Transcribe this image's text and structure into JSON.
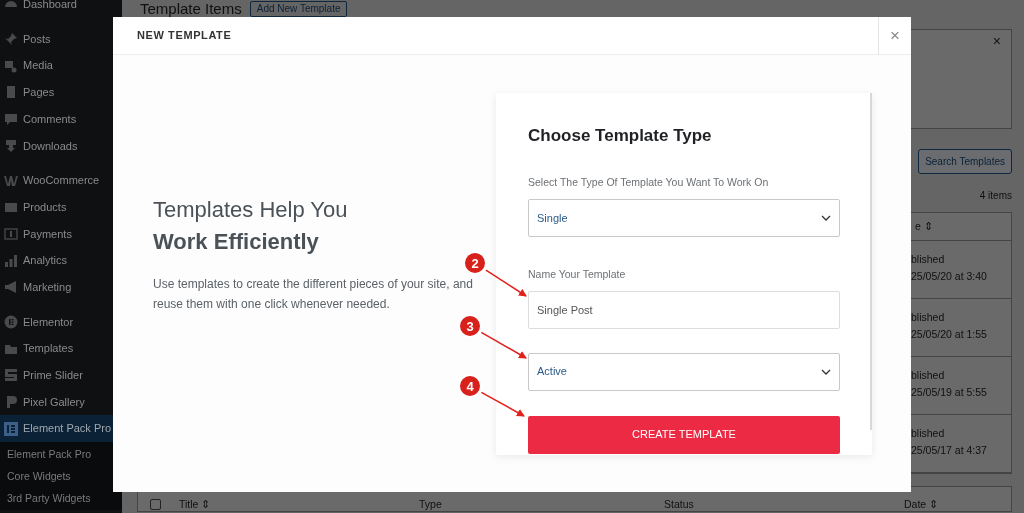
{
  "sidebar": {
    "groups": [
      {
        "items": [
          {
            "label": "Dashboard",
            "selected": false
          }
        ]
      },
      {
        "items": [
          {
            "label": "Posts",
            "selected": false
          },
          {
            "label": "Media",
            "selected": false
          },
          {
            "label": "Pages",
            "selected": false
          },
          {
            "label": "Comments",
            "selected": false
          },
          {
            "label": "Downloads",
            "selected": false
          }
        ]
      },
      {
        "items": [
          {
            "label": "WooCommerce",
            "selected": false
          },
          {
            "label": "Products",
            "selected": false
          },
          {
            "label": "Payments",
            "selected": false
          },
          {
            "label": "Analytics",
            "selected": false
          },
          {
            "label": "Marketing",
            "selected": false
          }
        ]
      },
      {
        "items": [
          {
            "label": "Elementor",
            "selected": false
          },
          {
            "label": "Templates",
            "selected": false
          },
          {
            "label": "Prime Slider",
            "selected": false
          },
          {
            "label": "Pixel Gallery",
            "selected": false
          },
          {
            "label": "Element Pack Pro",
            "selected": true
          }
        ]
      }
    ],
    "submenu": [
      {
        "label": "Element Pack Pro"
      },
      {
        "label": "Core Widgets"
      },
      {
        "label": "3rd Party Widgets"
      }
    ]
  },
  "page": {
    "title": "Template Items",
    "add_button": "Add New Template",
    "search_button": "Search Templates",
    "count": "4 items",
    "table": {
      "header": "e ⇕",
      "rows": [
        {
          "status": "blished",
          "date": "25/05/20 at 3:40"
        },
        {
          "status": "blished",
          "date": "25/05/20 at 1:55"
        },
        {
          "status": "blished",
          "date": "25/05/19 at 5:55"
        },
        {
          "status": "blished",
          "date": "25/05/17 at 4:37"
        }
      ],
      "select_all_checked": false,
      "footer": [
        "Title ⇕",
        "Type",
        "Status",
        "Date ⇕"
      ]
    },
    "notice_close": "×"
  },
  "modal": {
    "title": "NEW TEMPLATE",
    "close": "×",
    "intro": {
      "heading_light": "Templates Help You",
      "heading_bold": "Work Efficiently",
      "text": "Use templates to create the different pieces of your site, and reuse them with one click whenever needed."
    },
    "form": {
      "title": "Choose Template Type",
      "type_label": "Select The Type Of Template You Want To Work On",
      "type_value": "Single",
      "name_label": "Name Your Template",
      "name_value": "Single Post",
      "status_value": "Active",
      "submit": "CREATE TEMPLATE"
    }
  },
  "annotations": [
    {
      "label": "2"
    },
    {
      "label": "3"
    },
    {
      "label": "4"
    }
  ]
}
